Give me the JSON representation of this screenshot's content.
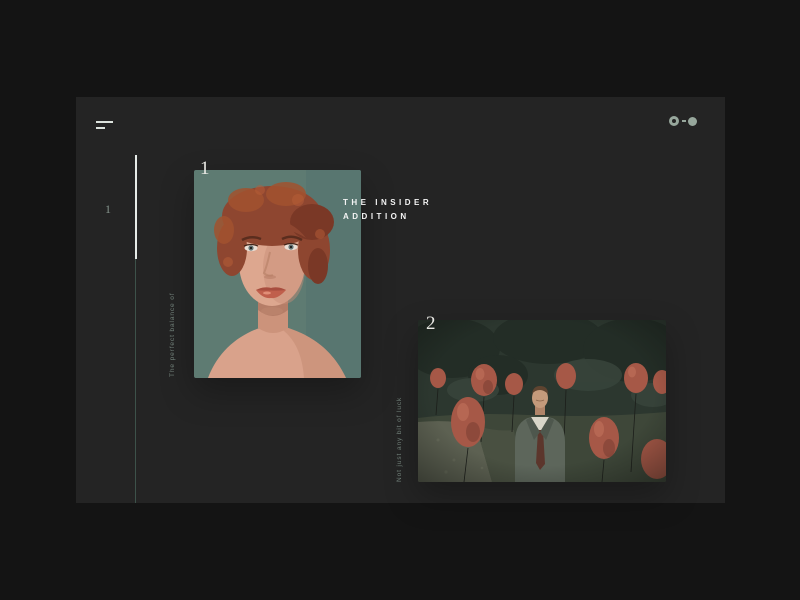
{
  "header": {
    "menu_icon": "hamburger-menu",
    "logo_icon": "ring-and-dot"
  },
  "pagination": {
    "current_page": "1"
  },
  "cards": [
    {
      "number": "1",
      "title": {
        "line1": "THE INSIDER",
        "line2": "ADDITION"
      },
      "caption": "The perfect balance of",
      "image_alt": "Portrait of a red-haired woman against a teal background"
    },
    {
      "number": "2",
      "caption": "Not just any bit of luck",
      "image_alt": "Man in a grey suit surrounded by floating red balloons in a dark forest"
    }
  ],
  "colors": {
    "page_bg": "#141414",
    "panel_bg": "#242424",
    "logo": "#97a79c",
    "menu_icon": "#dce2dd",
    "progress_track": "#3d524a",
    "progress_fill": "#e6ebe8",
    "title_text": "#f4f4f4",
    "caption_text": "#6f7e77",
    "numeral_text": "#e9e9e4",
    "page_number_text": "#84938c"
  }
}
